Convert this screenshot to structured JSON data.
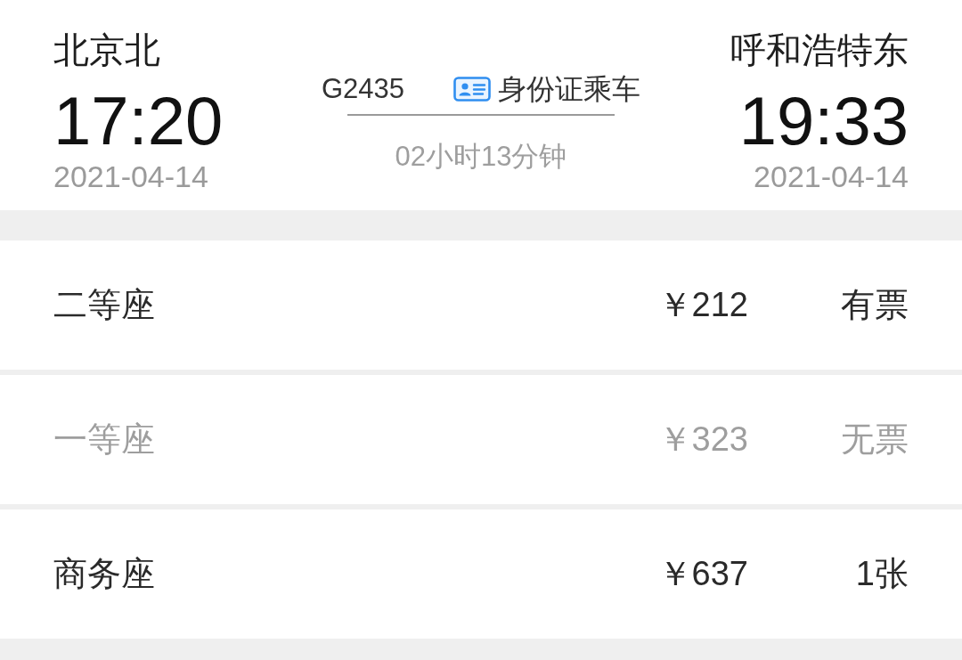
{
  "departure": {
    "station": "北京北",
    "time": "17:20",
    "date": "2021-04-14"
  },
  "train": {
    "number": "G2435",
    "boarding": "身份证乘车",
    "duration": "02小时13分钟"
  },
  "arrival": {
    "station": "呼和浩特东",
    "time": "19:33",
    "date": "2021-04-14"
  },
  "seats": [
    {
      "name": "二等座",
      "price": "￥212",
      "status": "有票",
      "available": true
    },
    {
      "name": "一等座",
      "price": "￥323",
      "status": "无票",
      "available": false
    },
    {
      "name": "商务座",
      "price": "￥637",
      "status": "1张",
      "available": true
    }
  ]
}
